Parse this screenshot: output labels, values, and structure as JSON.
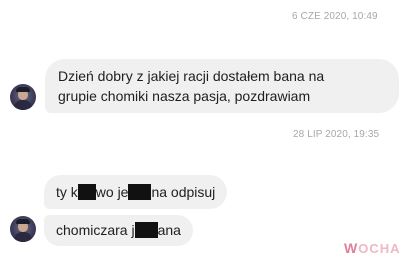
{
  "timestamps": {
    "first": "6 CZE 2020, 10:49",
    "second": "28 LIP 2020, 19:35"
  },
  "messages": [
    {
      "lines": [
        "Dzień dobry z jakiej racji dostałem  bana na",
        "grupie chomiki nasza pasja, pozdrawiam"
      ]
    },
    {
      "parts": [
        "ty k",
        "wo je",
        "na odpisuj"
      ]
    },
    {
      "parts": [
        "chomiczara j",
        "ana"
      ]
    }
  ],
  "avatar": {
    "icon": "user-avatar-icon"
  },
  "watermark": {
    "w": "W",
    "rest": "OCHA"
  },
  "colors": {
    "bubble": "#f0f0f1",
    "text": "#1e1e1e",
    "timestamp": "#a8a8a8",
    "redaction": "#111111",
    "watermark": "#e07f9a"
  }
}
